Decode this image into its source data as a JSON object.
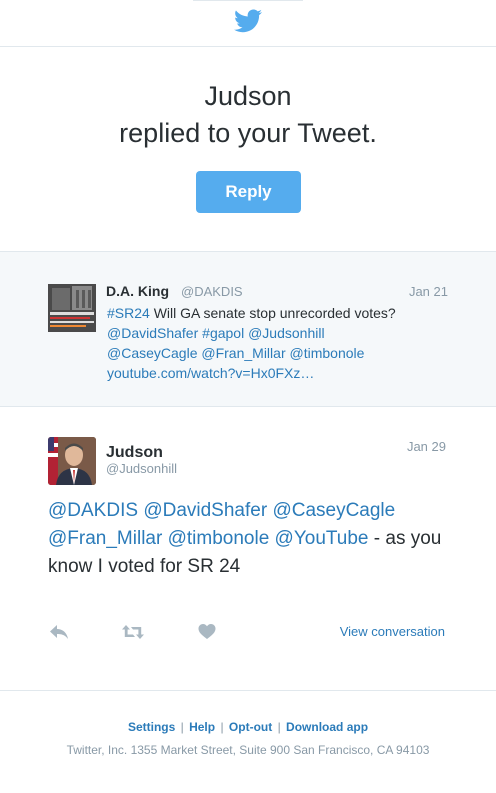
{
  "header": {
    "logo": "twitter-bird-icon",
    "colors": {
      "brand": "#55acee",
      "link": "#2b7bb9",
      "muted": "#8899a6",
      "panel": "#f5f8fa"
    }
  },
  "notification": {
    "actor": "Judson",
    "action": "replied to your Tweet.",
    "button_label": "Reply"
  },
  "original_tweet": {
    "author_name": "D.A. King",
    "author_handle": "@DAKDIS",
    "date": "Jan 21",
    "text_parts": [
      {
        "text": "#SR24",
        "link": true
      },
      {
        "text": " Will GA senate stop unrecorded votes? ",
        "link": false
      },
      {
        "text": "@DavidShafer",
        "link": true
      },
      {
        "text": " ",
        "link": false
      },
      {
        "text": "#gapol",
        "link": true
      },
      {
        "text": " ",
        "link": false
      },
      {
        "text": "@Judsonhill",
        "link": true
      },
      {
        "text": " ",
        "link": false
      },
      {
        "text": "@CaseyCagle",
        "link": true
      },
      {
        "text": " ",
        "link": false
      },
      {
        "text": "@Fran_Millar",
        "link": true
      },
      {
        "text": " ",
        "link": false
      },
      {
        "text": "@timbonole",
        "link": true
      },
      {
        "text": " ",
        "link": false
      },
      {
        "text": "youtube.com/watch?v=Hx0FXz…",
        "link": true
      }
    ]
  },
  "reply_tweet": {
    "author_name": "Judson",
    "author_handle": "@Judsonhill",
    "date": "Jan 29",
    "text_parts": [
      {
        "text": "@DAKDIS",
        "link": true
      },
      {
        "text": " ",
        "link": false
      },
      {
        "text": "@DavidShafer",
        "link": true
      },
      {
        "text": " ",
        "link": false
      },
      {
        "text": "@CaseyCagle",
        "link": true
      },
      {
        "text": " ",
        "link": false
      },
      {
        "text": "@Fran_Millar",
        "link": true
      },
      {
        "text": " ",
        "link": false
      },
      {
        "text": "@timbonole",
        "link": true
      },
      {
        "text": " ",
        "link": false
      },
      {
        "text": "@YouTube",
        "link": true
      },
      {
        "text": " - as you know I voted for SR 24",
        "link": false
      }
    ],
    "actions": {
      "reply_icon": "reply-icon",
      "retweet_icon": "retweet-icon",
      "favorite_icon": "heart-icon",
      "view_label": "View conversation"
    }
  },
  "footer": {
    "links": [
      "Settings",
      "Help",
      "Opt-out",
      "Download app"
    ],
    "separator": "|",
    "address": "Twitter, Inc. 1355 Market Street, Suite 900 San Francisco, CA 94103"
  }
}
